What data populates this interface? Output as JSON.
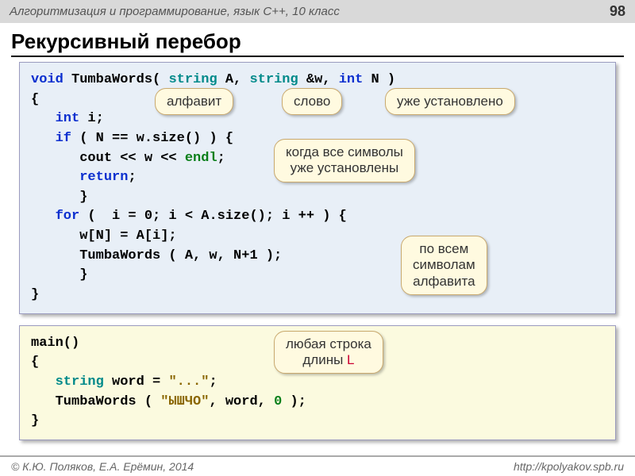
{
  "header": "Алгоритмизация и программирование, язык C++, 10 класс",
  "page_num": "98",
  "title": "Рекурсивный перебор",
  "code1": {
    "l1_a": "void",
    "l1_b": " TumbaWords( ",
    "l1_c": "string",
    "l1_d": " A, ",
    "l1_e": "string",
    "l1_f": " &w, ",
    "l1_g": "int",
    "l1_h": " N )",
    "l2": "{",
    "l3_a": "   ",
    "l3_b": "int",
    "l3_c": " i;",
    "l4_a": "   ",
    "l4_b": "if",
    "l4_c": " ( N == w.size() ) {",
    "l5_a": "      cout << w << ",
    "l5_b": "endl",
    "l5_c": ";",
    "l6_a": "      ",
    "l6_b": "return",
    "l6_c": ";",
    "l7": "      }",
    "l8_a": "   ",
    "l8_b": "for",
    "l8_c": " (  i = 0; i < A.size(); i ++ ) {",
    "l9": "      w[N] = A[i];",
    "l10": "      TumbaWords ( A, w, N+1 );",
    "l11": "      }",
    "l12": "}"
  },
  "code2": {
    "l1": "main()",
    "l2": "{",
    "l3_a": "   ",
    "l3_b": "string",
    "l3_c": " word = ",
    "l3_d": "\"...\"",
    "l3_e": ";",
    "l4_a": "   TumbaWords ( ",
    "l4_b": "\"ЫШЧО\"",
    "l4_c": ", word, ",
    "l4_d": "0",
    "l4_e": " );",
    "l5": "}"
  },
  "callouts": {
    "c1": "алфавит",
    "c2": "слово",
    "c3": "уже установлено",
    "c4_l1": "когда все символы",
    "c4_l2": "уже установлены",
    "c5_l1": "по всем",
    "c5_l2": "символам",
    "c5_l3": "алфавита",
    "c6_l1": "любая строка",
    "c6_l2a": "длины ",
    "c6_l2b": "L"
  },
  "footer_left": "© К.Ю. Поляков, Е.А. Ерёмин, 2014",
  "footer_right": "http://kpolyakov.spb.ru"
}
